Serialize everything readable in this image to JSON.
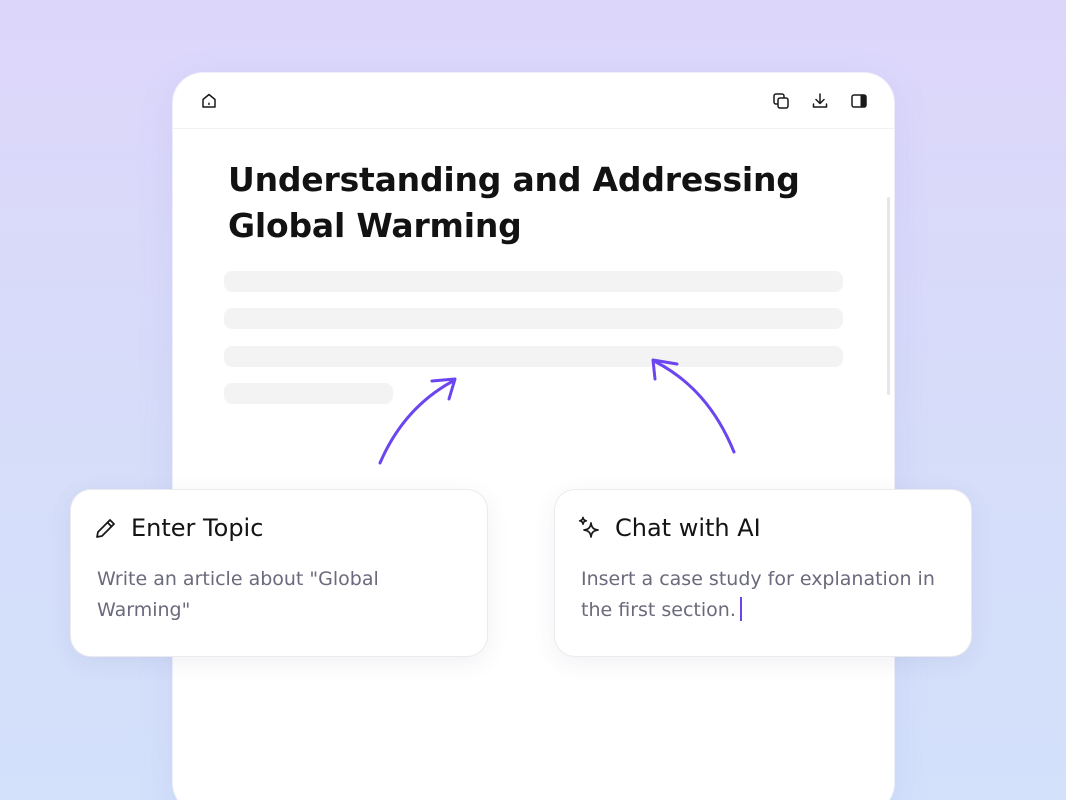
{
  "toolbar": {
    "left_icons": [
      "home-icon"
    ],
    "right_icons": [
      "duplicate-icon",
      "download-icon",
      "sidebar-panel-icon"
    ]
  },
  "document": {
    "title_line1": "Understanding and Addressing",
    "title_line2": "Global Warming"
  },
  "cards": {
    "enter_topic": {
      "icon": "pencil-icon",
      "title": "Enter Topic",
      "body": "Write an article about \"Global Warming\""
    },
    "chat_ai": {
      "icon": "sparkles-icon",
      "title": "Chat with AI",
      "body": "Insert a case study for explanation in the first section."
    }
  },
  "colors": {
    "accent": "#6b45f0",
    "skeleton": "#f3f3f3",
    "title_text": "#121212",
    "body_text": "#6a6a7c"
  }
}
